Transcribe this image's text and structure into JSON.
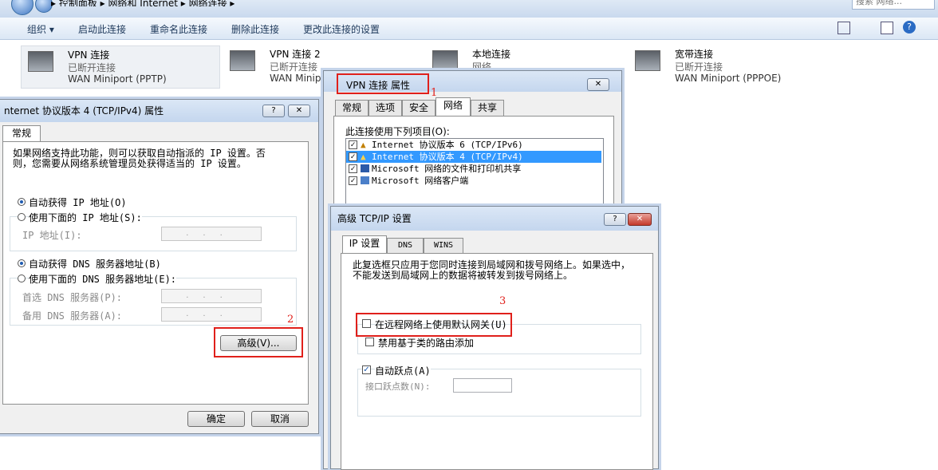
{
  "explorer": {
    "breadcrumb": "▸ 控制面板 ▸ 网络和 Internet ▸ 网络连接 ▸",
    "search_placeholder": "搜索 网络...",
    "toolbar": {
      "organize": "组织 ▾",
      "start_conn": "启动此连接",
      "rename": "重命名此连接",
      "delete": "删除此连接",
      "change": "更改此连接的设置"
    },
    "connections": [
      {
        "name": "VPN 连接",
        "status": "已断开连接",
        "device": "WAN Miniport (PPTP)"
      },
      {
        "name": "VPN 连接 2",
        "status": "已断开连接",
        "device": "WAN Minip"
      },
      {
        "name": "本地连接",
        "status": "网络",
        "device": ""
      },
      {
        "name": "宽带连接",
        "status": "已断开连接",
        "device": "WAN Miniport (PPPOE)"
      }
    ]
  },
  "ipv4_dialog": {
    "title": "nternet 协议版本 4 (TCP/IPv4) 属性",
    "help_btn": "?",
    "close_btn": "✕",
    "tab": "常规",
    "description": "如果网络支持此功能，则可以获取自动指派的 IP 设置。否则，您需要从网络系统管理员处获得适当的 IP 设置。",
    "auto_ip": "自动获得 IP 地址(O)",
    "manual_ip": "使用下面的 IP 地址(S):",
    "ip_label": "IP 地址(I):",
    "auto_dns": "自动获得 DNS 服务器地址(B)",
    "manual_dns": "使用下面的 DNS 服务器地址(E):",
    "dns1_label": "首选 DNS 服务器(P):",
    "dns2_label": "备用 DNS 服务器(A):",
    "field_dots": "...",
    "advanced_btn": "高级(V)...",
    "ok_btn": "确定",
    "cancel_btn": "取消",
    "annotation": "2"
  },
  "vpn_dialog": {
    "title": "VPN 连接 属性",
    "close_btn": "✕",
    "annotation": "1",
    "tabs": [
      "常规",
      "选项",
      "安全",
      "网络",
      "共享"
    ],
    "list_label": "此连接使用下列项目(O):",
    "items": [
      "Internet 协议版本 6 (TCP/IPv6)",
      "Internet 协议版本 4 (TCP/IPv4)",
      "Microsoft 网络的文件和打印机共享",
      "Microsoft 网络客户端"
    ]
  },
  "adv_dialog": {
    "title": "高级 TCP/IP 设置",
    "help_btn": "?",
    "close_btn": "✕",
    "tabs": [
      "IP 设置",
      "DNS",
      "WINS"
    ],
    "description": "此复选框只应用于您同时连接到局域网和拨号网络上。如果选中，不能发送到局域网上的数据将被转发到拨号网络上。",
    "annotation": "3",
    "use_gateway": "在远程网络上使用默认网关(U)",
    "disable_class": "禁用基于类的路由添加",
    "auto_metric": "自动跃点(A)",
    "metric_label": "接口跃点数(N):",
    "check_mark": "✓"
  },
  "colors": {
    "annotation_red": "#e0201b",
    "selection_blue": "#3399ff"
  }
}
